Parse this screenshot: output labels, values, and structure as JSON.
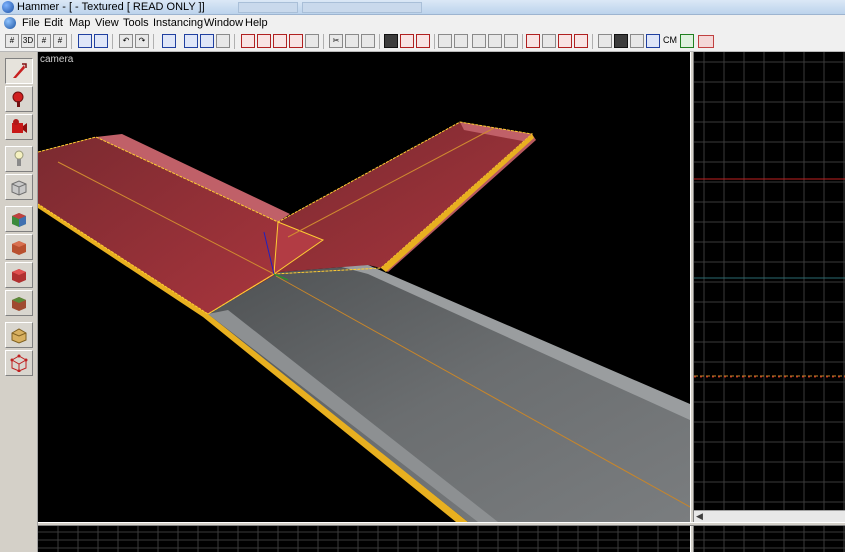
{
  "window": {
    "title": "Hammer - [ - Textured [ READ ONLY ]]"
  },
  "menu": {
    "items": [
      "File",
      "Edit",
      "Map",
      "View",
      "Tools",
      "Instancing",
      "Window",
      "Help"
    ]
  },
  "toolbar": {
    "cm_label": "CM"
  },
  "tools": {
    "items": [
      {
        "name": "selection-tool",
        "icon": "pointer-icon"
      },
      {
        "name": "magnify-tool",
        "icon": "magnifier-icon"
      },
      {
        "name": "camera-tool",
        "icon": "camera-icon"
      },
      {
        "name": "entity-tool",
        "icon": "light-entity-icon"
      },
      {
        "name": "block-tool",
        "icon": "block-icon"
      },
      {
        "name": "texture-application-tool",
        "icon": "texture-apply-icon"
      },
      {
        "name": "apply-current-texture-tool",
        "icon": "texture-current-icon"
      },
      {
        "name": "decal-tool",
        "icon": "decal-icon"
      },
      {
        "name": "overlay-tool",
        "icon": "overlay-icon"
      },
      {
        "name": "clipping-tool",
        "icon": "clip-icon"
      },
      {
        "name": "vertex-tool",
        "icon": "vertex-icon"
      }
    ]
  },
  "viewport3d": {
    "label": "camera"
  },
  "colors": {
    "viewport_bg": "#000000",
    "selection_tint": "#a8353d",
    "selection_outline": "#ffcc33",
    "road_surface": "#6b6e70",
    "grid_line": "#3a3a3a",
    "axis_red": "#c02020",
    "axis_cyan": "#2a6a70"
  }
}
